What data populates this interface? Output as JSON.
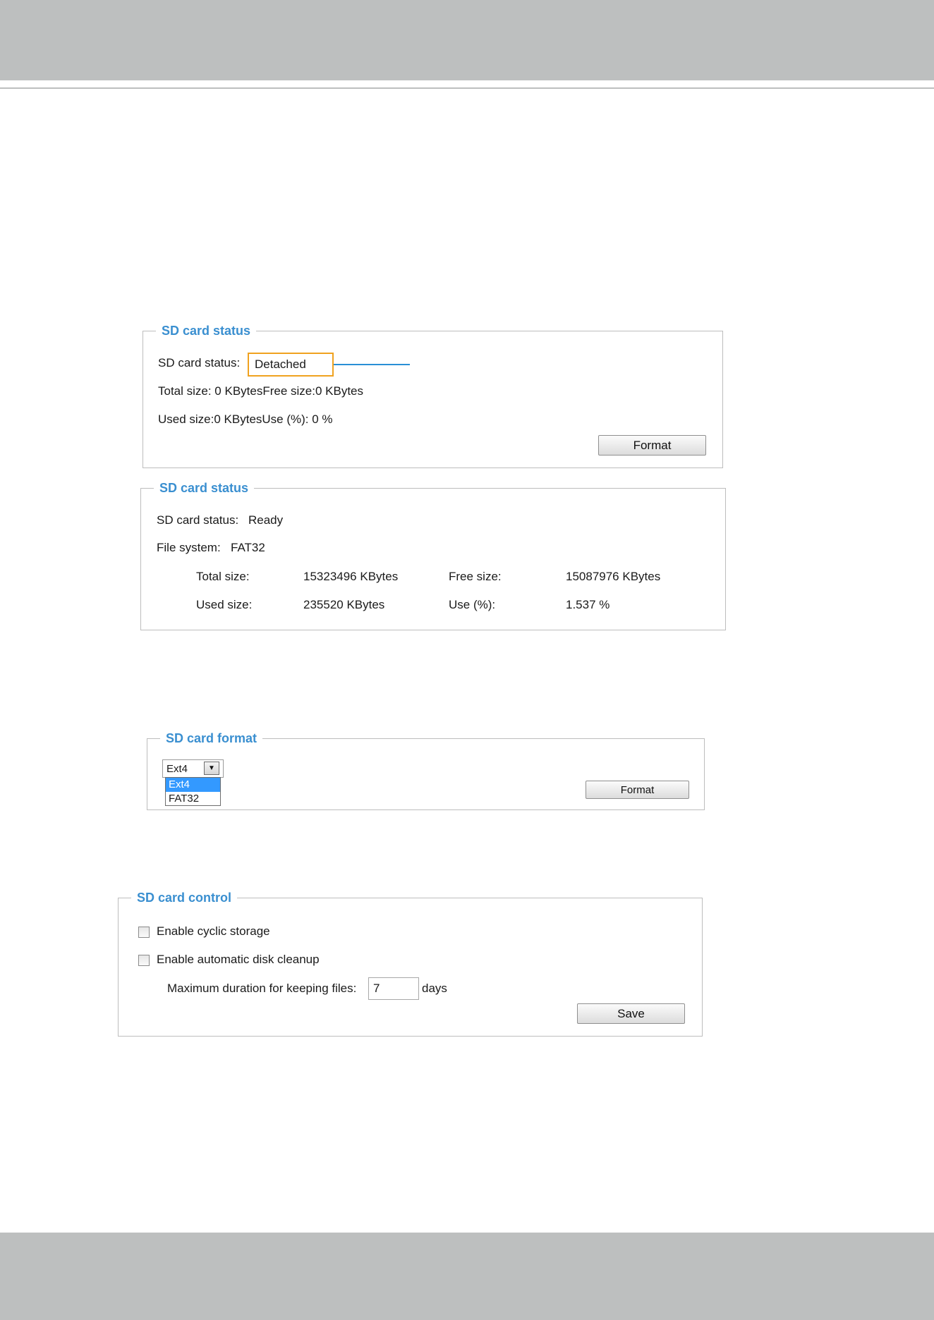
{
  "panel1": {
    "legend": "SD card status",
    "status_label": "SD card status:",
    "status_value": "Detached",
    "size_line": "Total size: 0  KBytesFree size:0  KBytes",
    "used_line": "Used size:0  KBytesUse (%): 0 %",
    "format_button": "Format"
  },
  "panel2": {
    "legend": "SD card status",
    "status_label": "SD card status:",
    "status_value": "Ready",
    "fs_label": "File system:",
    "fs_value": "FAT32",
    "total_label": "Total size:",
    "total_value": "15323496  KBytes",
    "free_label": "Free size:",
    "free_value": "15087976  KBytes",
    "used_label": "Used size:",
    "used_value": "235520  KBytes",
    "use_label": "Use (%):",
    "use_value": "1.537 %"
  },
  "panel3": {
    "legend": "SD card format",
    "selected": "Ext4",
    "options": [
      "Ext4",
      "FAT32"
    ],
    "format_button": "Format"
  },
  "panel4": {
    "legend": "SD card control",
    "cyclic_label": "Enable cyclic storage",
    "cleanup_label": "Enable automatic disk cleanup",
    "max_label": "Maximum duration for keeping files:",
    "max_value": "7",
    "days_label": "days",
    "save_button": "Save"
  },
  "colors": {
    "legend": "#3a8fd0",
    "band": "#bdbfbf",
    "highlight": "#f0a21f",
    "callout": "#2a8fd6",
    "selected_option": "#3399ff"
  }
}
